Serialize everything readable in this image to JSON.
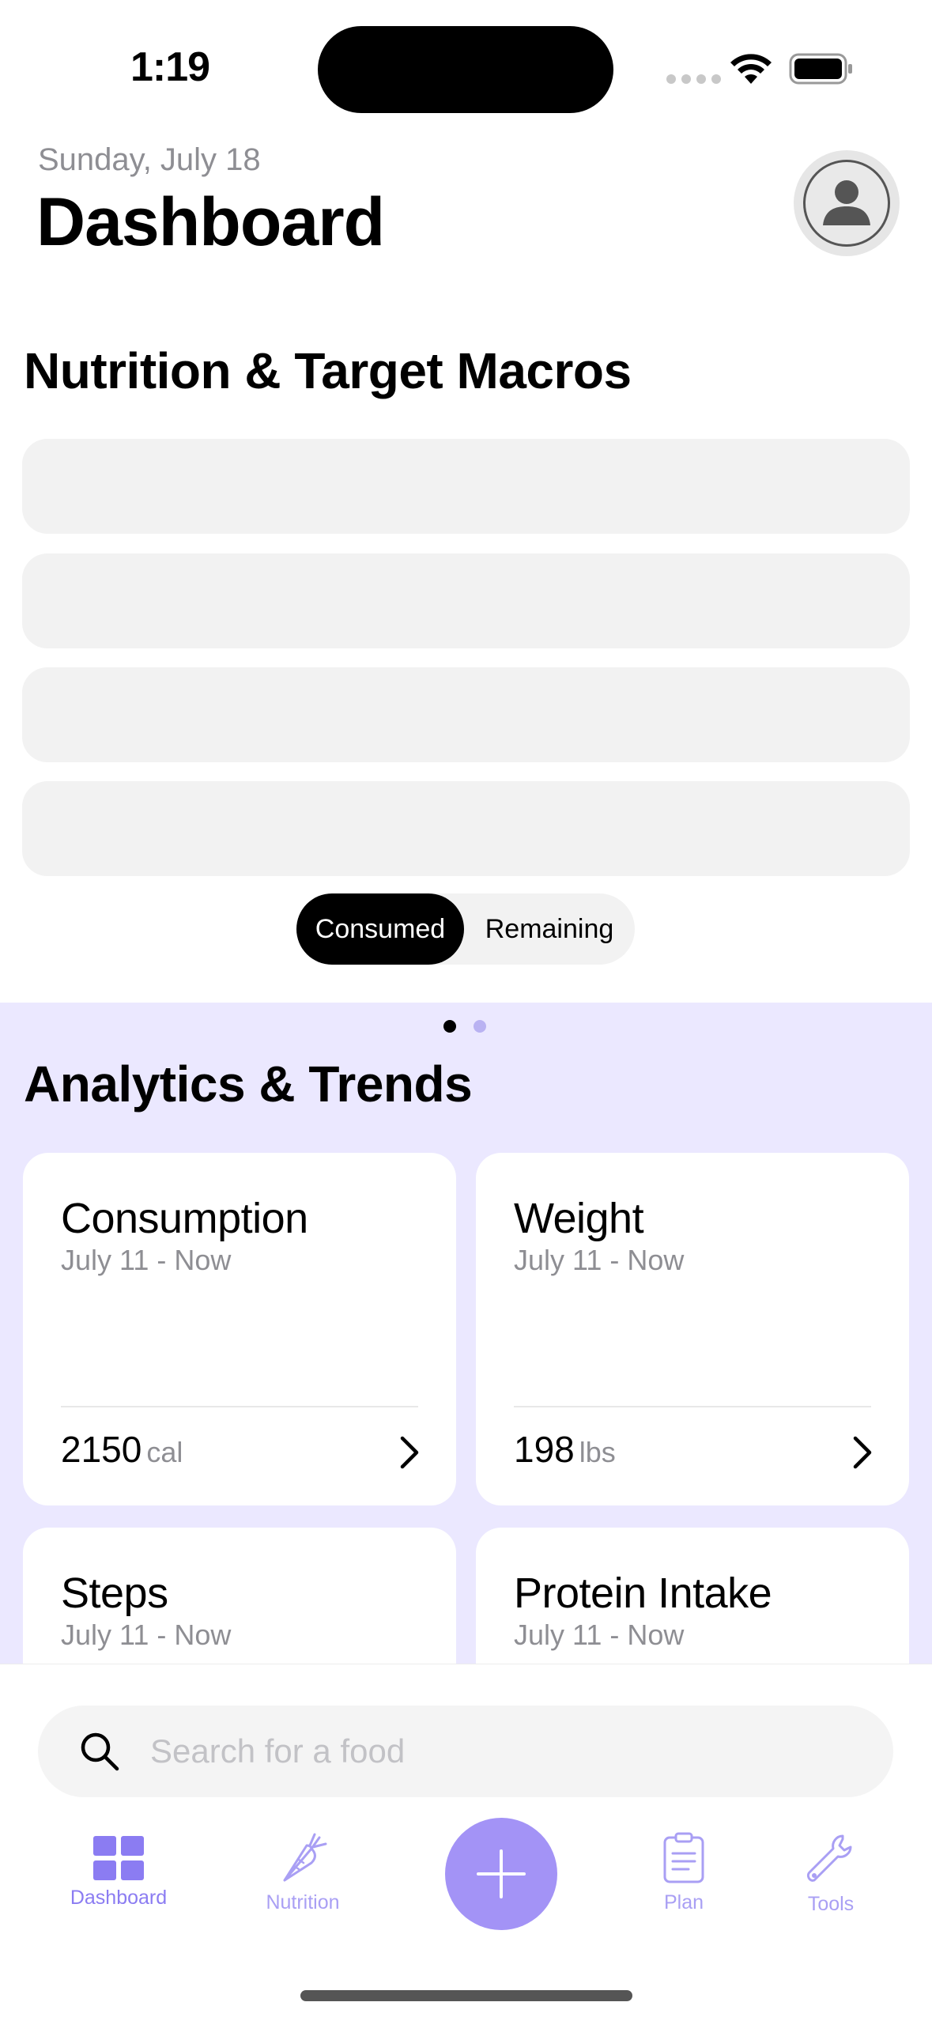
{
  "status_bar": {
    "time": "1:19"
  },
  "header": {
    "date": "Sunday, July 18",
    "title": "Dashboard"
  },
  "nutrition": {
    "title": "Nutrition & Target Macros",
    "toggle": {
      "active": "Consumed",
      "inactive": "Remaining"
    }
  },
  "pager": {
    "pages": 2,
    "current": 1
  },
  "analytics": {
    "title": "Analytics & Trends",
    "cards": [
      {
        "title": "Consumption",
        "range": "July 11 - Now",
        "value": "2150",
        "unit": "cal"
      },
      {
        "title": "Weight",
        "range": "July 11 - Now",
        "value": "198",
        "unit": "lbs"
      },
      {
        "title": "Steps",
        "range": "July 11 - Now"
      },
      {
        "title": "Protein Intake",
        "range": "July 11 - Now"
      }
    ]
  },
  "search": {
    "placeholder": "Search for a food"
  },
  "tabbar": {
    "items": [
      {
        "label": "Dashboard",
        "icon": "grid-icon",
        "active": true
      },
      {
        "label": "Nutrition",
        "icon": "carrot-icon"
      },
      {
        "label": "Plan",
        "icon": "clipboard-icon"
      },
      {
        "label": "Tools",
        "icon": "wrench-icon"
      }
    ],
    "add_icon": "plus-icon"
  },
  "colors": {
    "accent": "#a393f6",
    "analytics_bg": "#ebe8ff",
    "tab_active": "#8b7cf2",
    "tab_inactive": "#a99ff4"
  }
}
